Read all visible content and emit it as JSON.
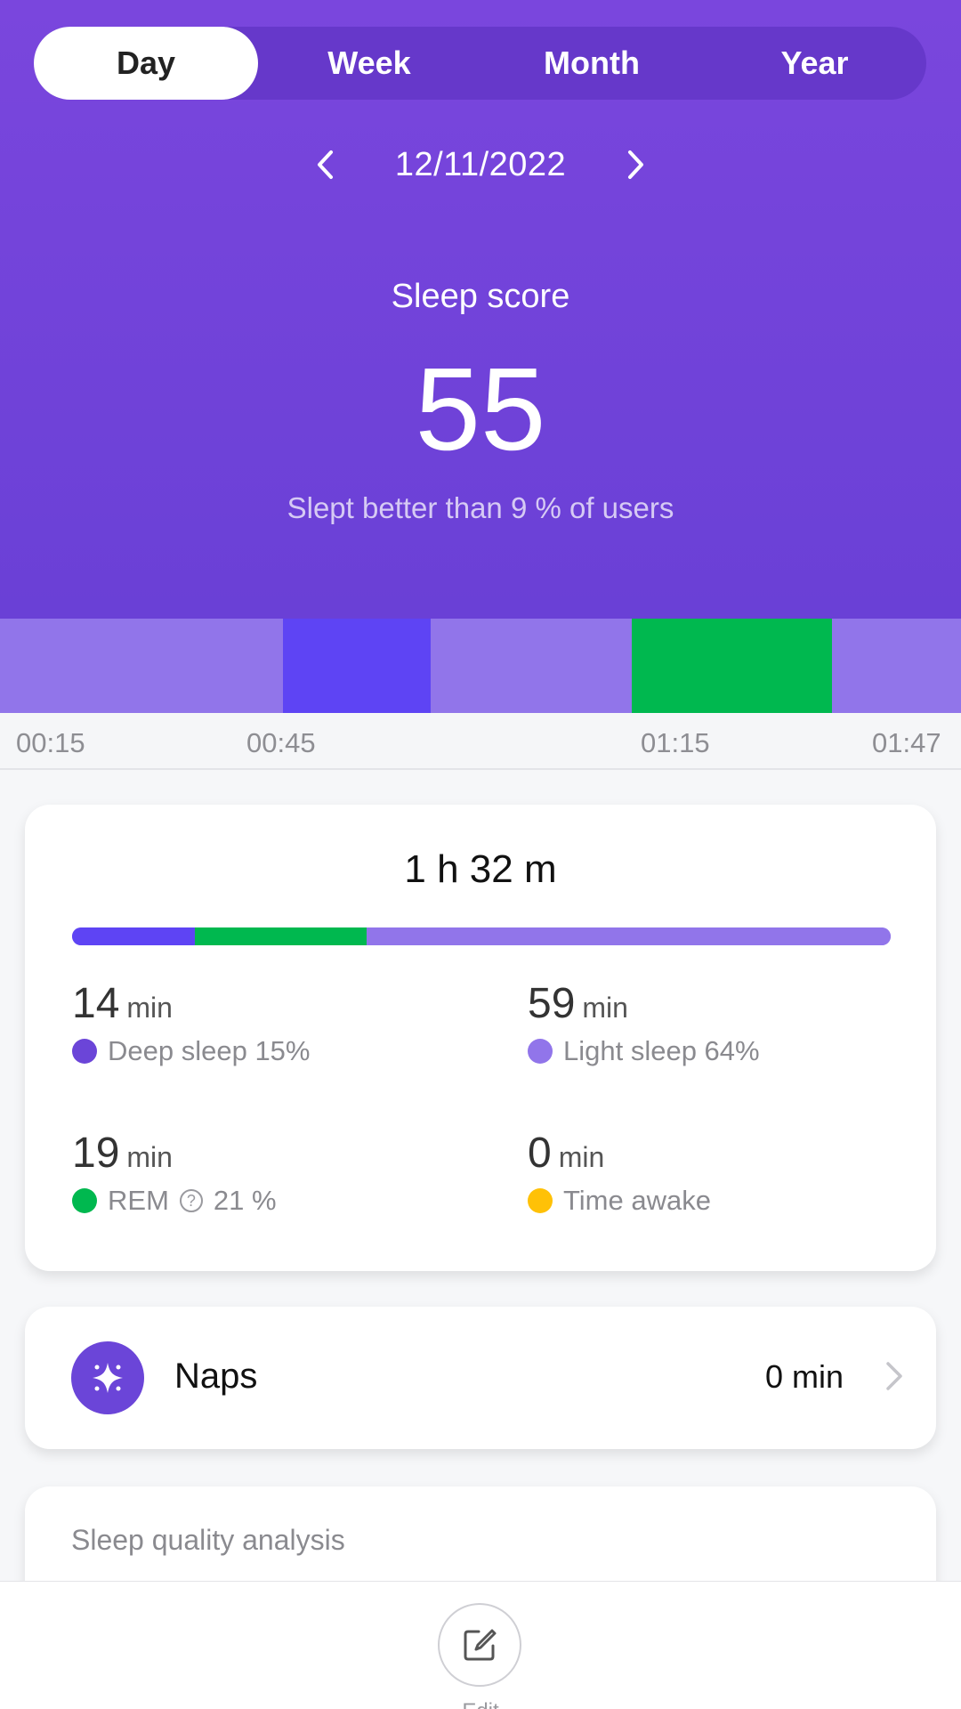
{
  "tabs": [
    {
      "label": "Day",
      "active": true
    },
    {
      "label": "Week",
      "active": false
    },
    {
      "label": "Month",
      "active": false
    },
    {
      "label": "Year",
      "active": false
    }
  ],
  "date": "12/11/2022",
  "score": {
    "label": "Sleep score",
    "value": "55",
    "comparison": "Slept better than 9 % of users"
  },
  "timeline": {
    "segments": [
      {
        "stage": "light"
      },
      {
        "stage": "deep"
      },
      {
        "stage": "light"
      },
      {
        "stage": "rem"
      },
      {
        "stage": "light"
      }
    ],
    "ticks": [
      "00:15",
      "00:45",
      "01:15",
      "01:47"
    ]
  },
  "summary": {
    "total": "1 h 32 m",
    "stages": {
      "deep": {
        "value": "14",
        "unit": "min",
        "label": "Deep sleep 15%",
        "percent": 15
      },
      "light": {
        "value": "59",
        "unit": "min",
        "label": "Light sleep 64%",
        "percent": 64
      },
      "rem": {
        "value": "19",
        "unit": "min",
        "label_prefix": "REM",
        "label_suffix": "21 %",
        "percent": 21
      },
      "awake": {
        "value": "0",
        "unit": "min",
        "label": "Time awake",
        "percent": 0
      }
    }
  },
  "naps": {
    "label": "Naps",
    "value": "0 min"
  },
  "analysis": {
    "title": "Sleep quality analysis"
  },
  "bottom": {
    "edit_label": "Edit"
  },
  "colors": {
    "header": "#7a46dd",
    "deep": "#5e44f4",
    "light": "#9175ea",
    "rem": "#00b84f",
    "awake": "#ffc107",
    "deep_dot": "#6b45d8"
  }
}
